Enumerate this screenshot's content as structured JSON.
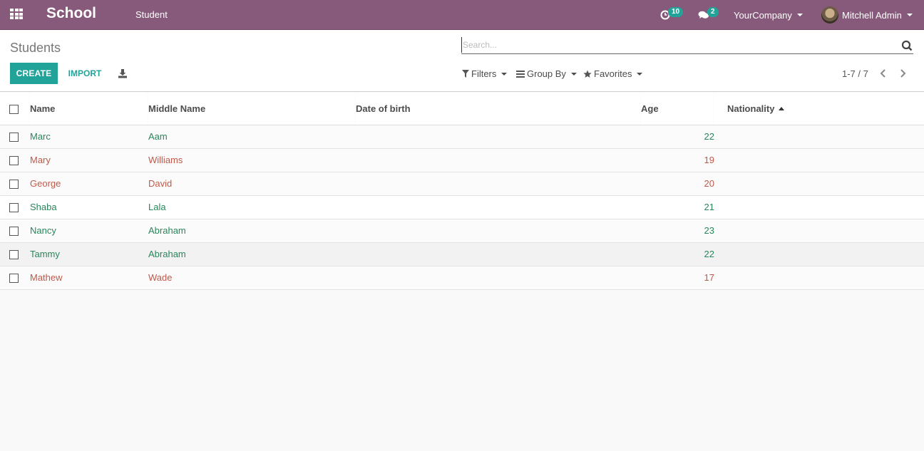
{
  "navbar": {
    "app_name": "School",
    "menu_item": "Student",
    "activity_count": "10",
    "message_count": "2",
    "company": "YourCompany",
    "user": "Mitchell Admin"
  },
  "control_panel": {
    "title": "Students",
    "create_label": "CREATE",
    "import_label": "IMPORT",
    "search_placeholder": "Search...",
    "filters_label": "Filters",
    "groupby_label": "Group By",
    "favorites_label": "Favorites",
    "pager": "1-7 / 7"
  },
  "table": {
    "columns": [
      "Name",
      "Middle Name",
      "Date of birth",
      "Age",
      "Nationality"
    ],
    "sorted_column": "Nationality",
    "sort_direction": "ascending",
    "rows": [
      {
        "name": "Marc",
        "middle": "Aam",
        "dob": "",
        "age": "22",
        "nationality": "",
        "status": "green"
      },
      {
        "name": "Mary",
        "middle": "Williams",
        "dob": "",
        "age": "19",
        "nationality": "",
        "status": "red"
      },
      {
        "name": "George",
        "middle": "David",
        "dob": "",
        "age": "20",
        "nationality": "",
        "status": "red"
      },
      {
        "name": "Shaba",
        "middle": "Lala",
        "dob": "",
        "age": "21",
        "nationality": "",
        "status": "green"
      },
      {
        "name": "Nancy",
        "middle": "Abraham",
        "dob": "",
        "age": "23",
        "nationality": "",
        "status": "green"
      },
      {
        "name": "Tammy",
        "middle": "Abraham",
        "dob": "",
        "age": "22",
        "nationality": "",
        "status": "green"
      },
      {
        "name": "Mathew",
        "middle": "Wade",
        "dob": "",
        "age": "17",
        "nationality": "",
        "status": "red"
      }
    ]
  },
  "colors": {
    "navbar": "#875a7b",
    "primary": "#22a39a",
    "green_text": "#28865a",
    "red_text": "#c0594a"
  }
}
